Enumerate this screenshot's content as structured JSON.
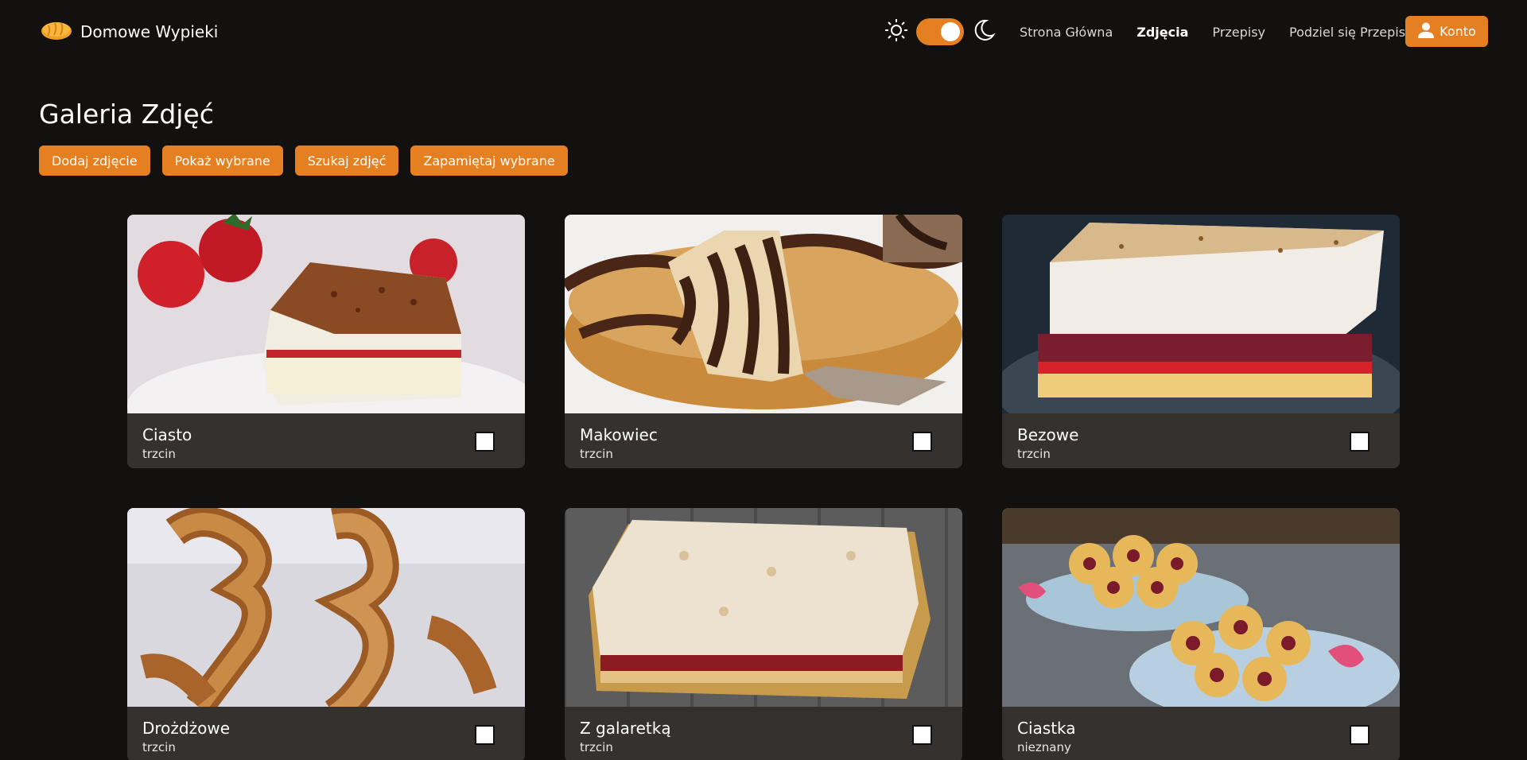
{
  "header": {
    "brand": "Domowe Wypieki",
    "theme": {
      "mode": "dark",
      "light_icon": "sun-icon",
      "dark_icon": "moon-icon"
    },
    "nav": [
      {
        "label": "Strona Główna",
        "active": false
      },
      {
        "label": "Zdjęcia",
        "active": true
      },
      {
        "label": "Przepisy",
        "active": false
      },
      {
        "label": "Podziel się Przepisem",
        "active": false
      }
    ],
    "account_label": "Konto",
    "accent": "#e47f22"
  },
  "page": {
    "title": "Galeria Zdjęć",
    "actions": [
      "Dodaj zdjęcie",
      "Pokaż wybrane",
      "Szukaj zdjęć",
      "Zapamiętaj wybrane"
    ]
  },
  "gallery": [
    {
      "title": "Ciasto",
      "author": "trzcin",
      "checked": false
    },
    {
      "title": "Makowiec",
      "author": "trzcin",
      "checked": false
    },
    {
      "title": "Bezowe",
      "author": "trzcin",
      "checked": false
    },
    {
      "title": "Drożdżowe",
      "author": "trzcin",
      "checked": false
    },
    {
      "title": "Z galaretką",
      "author": "trzcin",
      "checked": false
    },
    {
      "title": "Ciastka",
      "author": "nieznany",
      "checked": false
    }
  ]
}
